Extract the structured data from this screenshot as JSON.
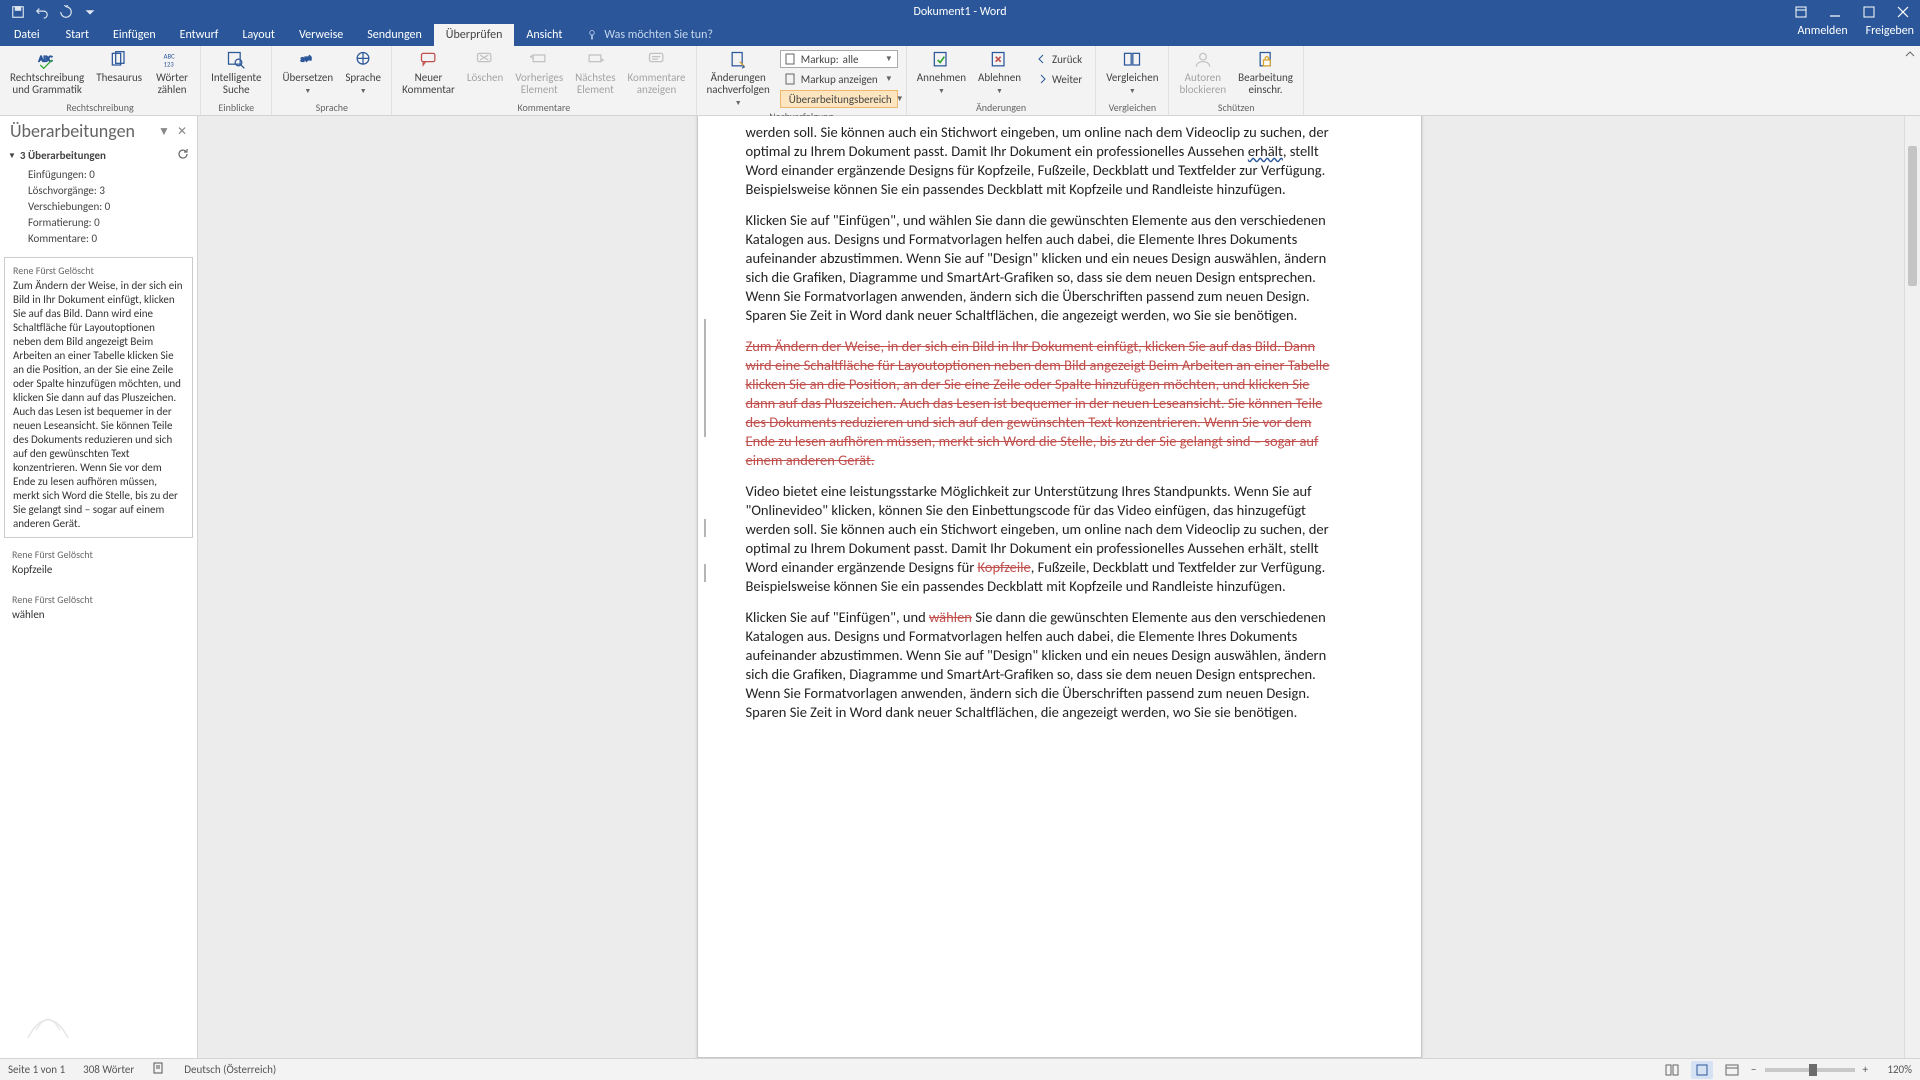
{
  "title": "Dokument1 - Word",
  "tabs": {
    "file": "Datei",
    "items": [
      "Start",
      "Einfügen",
      "Entwurf",
      "Layout",
      "Verweise",
      "Sendungen",
      "Überprüfen",
      "Ansicht"
    ],
    "active": 6,
    "tell_me": "Was möchten Sie tun?",
    "signin": "Anmelden",
    "share": "Freigeben"
  },
  "ribbon": {
    "groups": {
      "proofing": "Rechtschreibung",
      "insights": "Einblicke",
      "language": "Sprache",
      "comments": "Kommentare",
      "tracking": "Nachverfolgung",
      "changes": "Änderungen",
      "compare": "Vergleichen",
      "protect": "Schützen"
    },
    "buttons": {
      "spelling": "Rechtschreibung\nund Grammatik",
      "thesaurus": "Thesaurus",
      "wordcount": "Wörter\nzählen",
      "smart_lookup": "Intelligente\nSuche",
      "translate": "Übersetzen",
      "language": "Sprache",
      "new_comment": "Neuer\nKommentar",
      "delete_comment": "Löschen",
      "prev_comment": "Vorheriges\nElement",
      "next_comment": "Nächstes\nElement",
      "show_comments": "Kommentare\nanzeigen",
      "track": "Änderungen\nnachverfolgen",
      "markup_label": "Markup:",
      "markup_value": "alle",
      "show_markup": "Markup anzeigen",
      "reviewing_pane": "Überarbeitungsbereich",
      "accept": "Annehmen",
      "reject": "Ablehnen",
      "back": "Zurück",
      "next": "Weiter",
      "compare": "Vergleichen",
      "block_authors": "Autoren\nblockieren",
      "restrict": "Bearbeitung\neinschr."
    }
  },
  "revpane": {
    "title": "Überarbeitungen",
    "summary_head": "3 Überarbeitungen",
    "summary": {
      "insertions": "Einfügungen: 0",
      "deletions": "Löschvorgänge: 3",
      "moves": "Verschiebungen: 0",
      "formatting": "Formatierung: 0",
      "comments": "Kommentare: 0"
    },
    "items": [
      {
        "author": "Rene Fürst Gelöscht",
        "text": "Zum Ändern der Weise, in der sich ein Bild in Ihr Dokument einfügt, klicken Sie auf das Bild. Dann wird eine Schaltfläche für Layoutoptionen neben dem Bild angezeigt Beim Arbeiten an einer Tabelle klicken Sie an die Position, an der Sie eine Zeile oder Spalte hinzufügen möchten, und klicken Sie dann auf das Pluszeichen. Auch das Lesen ist bequemer in der neuen Leseansicht. Sie können Teile des Dokuments reduzieren und sich auf den gewünschten Text konzentrieren. Wenn Sie vor dem Ende zu lesen aufhören müssen, merkt sich Word die Stelle, bis zu der Sie gelangt sind – sogar auf einem anderen Gerät."
      },
      {
        "author": "Rene Fürst Gelöscht",
        "text": "Kopfzeile"
      },
      {
        "author": "Rene Fürst Gelöscht",
        "text": "wählen"
      }
    ]
  },
  "doc": {
    "para1_a": "werden soll. Sie können auch ein Stichwort eingeben, um online nach dem Videoclip zu suchen, der optimal zu Ihrem Dokument passt. Damit Ihr Dokument ein professionelles Aussehen ",
    "para1_wavy": "erhält",
    "para1_b": ", stellt Word einander ergänzende Designs für Kopfzeile, Fußzeile, Deckblatt und Textfelder zur Verfügung. Beispielsweise können Sie ein passendes Deckblatt mit Kopfzeile und Randleiste hinzufügen.",
    "para2": "Klicken Sie auf \"Einfügen\", und wählen Sie dann die gewünschten Elemente aus den verschiedenen Katalogen aus. Designs und Formatvorlagen helfen auch dabei, die Elemente Ihres Dokuments aufeinander abzustimmen. Wenn Sie auf \"Design\" klicken und ein neues Design auswählen, ändern sich die Grafiken, Diagramme und SmartArt-Grafiken so, dass sie dem neuen Design entsprechen. Wenn Sie Formatvorlagen anwenden, ändern sich die Überschriften passend zum neuen Design. Sparen Sie Zeit in Word dank neuer Schaltflächen, die angezeigt werden, wo Sie sie benötigen.",
    "para3_del": "Zum Ändern der Weise, in der sich ein Bild in Ihr Dokument einfügt, klicken Sie auf das Bild. Dann wird eine Schaltfläche für Layoutoptionen neben dem Bild angezeigt Beim Arbeiten an einer Tabelle klicken Sie an die Position, an der Sie eine Zeile oder Spalte hinzufügen möchten, und klicken Sie dann auf das Pluszeichen. Auch das Lesen ist bequemer in der neuen Leseansicht. Sie können Teile des Dokuments reduzieren und sich auf den gewünschten Text konzentrieren. Wenn Sie vor dem Ende zu lesen aufhören müssen, merkt sich Word die Stelle, bis zu der Sie gelangt sind – sogar auf einem anderen Gerät.",
    "para4_a": "Video bietet eine leistungsstarke Möglichkeit zur Unterstützung Ihres Standpunkts. Wenn Sie auf \"Onlinevideo\" klicken, können Sie den Einbettungscode für das Video einfügen, das hinzugefügt werden soll. Sie können auch ein Stichwort eingeben, um online nach dem Videoclip zu suchen, der optimal zu Ihrem Dokument passt. Damit Ihr Dokument ein professionelles Aussehen erhält, stellt Word einander ergänzende Designs für ",
    "para4_del": "Kopfzeile",
    "para4_b": ", Fußzeile, Deckblatt und Textfelder zur Verfügung. Beispielsweise können Sie ein passendes Deckblatt mit Kopfzeile und Randleiste hinzufügen.",
    "para5_a": "Klicken Sie auf \"Einfügen\", und ",
    "para5_del": "wählen",
    "para5_b": " Sie dann die gewünschten Elemente aus den verschiedenen Katalogen aus. Designs und Formatvorlagen helfen auch dabei, die Elemente Ihres Dokuments aufeinander abzustimmen. Wenn Sie auf \"Design\" klicken und ein neues Design auswählen, ändern sich die Grafiken, Diagramme und SmartArt-Grafiken so, dass sie dem neuen Design entsprechen. Wenn Sie Formatvorlagen anwenden, ändern sich die Überschriften passend zum neuen Design. Sparen Sie Zeit in Word dank neuer Schaltflächen, die angezeigt werden, wo Sie sie benötigen."
  },
  "status": {
    "page": "Seite 1 von 1",
    "words": "308 Wörter",
    "lang": "Deutsch (Österreich)",
    "zoom": "120%"
  }
}
